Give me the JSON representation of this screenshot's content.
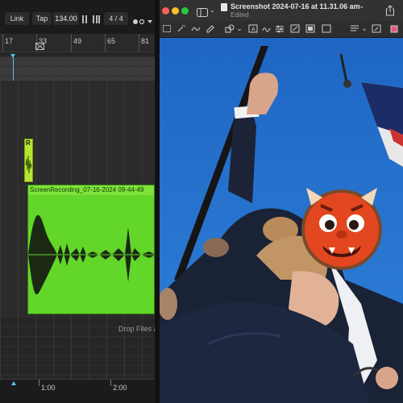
{
  "daw": {
    "toolbar": {
      "link_label": "Link",
      "tap_label": "Tap",
      "tempo": "134.00",
      "time_sig_num": "4",
      "time_sig_slash": "/",
      "time_sig_den": "4"
    },
    "ruler": {
      "bars": [
        "17",
        "33",
        "49",
        "65",
        "81"
      ]
    },
    "small_clip": {
      "label": "R"
    },
    "clip": {
      "name": "ScreenRecording_07-16-2024 09-44-49"
    },
    "drop_hint": "Drop Files a",
    "timeline": {
      "times": [
        "1:00",
        "2:00"
      ]
    },
    "colors": {
      "clip_green": "#62d629",
      "playhead": "#56c8e6"
    }
  },
  "preview": {
    "window_title": "Screenshot 2024-07-16 at 11.31.06 am",
    "title_chevron": "⌄",
    "subtitle": "Edited",
    "colors": {
      "close": "#ff5f57",
      "minimize": "#febc2e",
      "zoom": "#28c840"
    },
    "toolbar_icons": [
      "rect-select-icon",
      "magic-select-icon",
      "sketch-icon",
      "draw-icon",
      "shapes-icon",
      "text-icon",
      "sign-icon",
      "adjust-color-icon",
      "adjust-size-icon",
      "shape-style-icon",
      "border-color-icon",
      "fill-color-icon",
      "text-style-icon",
      "annotate-icon"
    ],
    "photo": {
      "image_label": "raised-fist-photo-with-devil-emoji"
    }
  }
}
